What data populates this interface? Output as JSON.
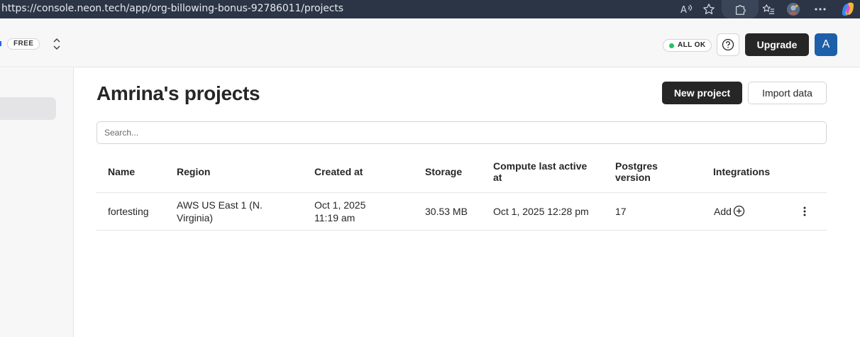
{
  "browser": {
    "url": "https://console.neon.tech/app/org-billowing-bonus-92786011/projects"
  },
  "header": {
    "plan_badge": "FREE",
    "status": "ALL OK",
    "upgrade_label": "Upgrade",
    "avatar_initial": "A",
    "colors": {
      "dark_button": "#262626",
      "avatar": "#1d5fa8",
      "status_ok": "#22c55e"
    }
  },
  "main": {
    "title": "Amrina's projects",
    "new_project_label": "New project",
    "import_label": "Import data",
    "search_placeholder": "Search...",
    "columns": {
      "name": "Name",
      "region": "Region",
      "created": "Created at",
      "storage": "Storage",
      "compute_line1": "Compute last active",
      "compute_line2": "at",
      "postgres_line1": "Postgres",
      "postgres_line2": "version",
      "integrations": "Integrations"
    },
    "rows": [
      {
        "name": "fortesting",
        "region_line1": "AWS US East 1 (N.",
        "region_line2": "Virginia)",
        "created_line1": "Oct 1, 2025",
        "created_line2": "11:19 am",
        "storage": "30.53 MB",
        "compute": "Oct 1, 2025 12:28 pm",
        "postgres": "17",
        "integrations": "Add"
      }
    ]
  }
}
